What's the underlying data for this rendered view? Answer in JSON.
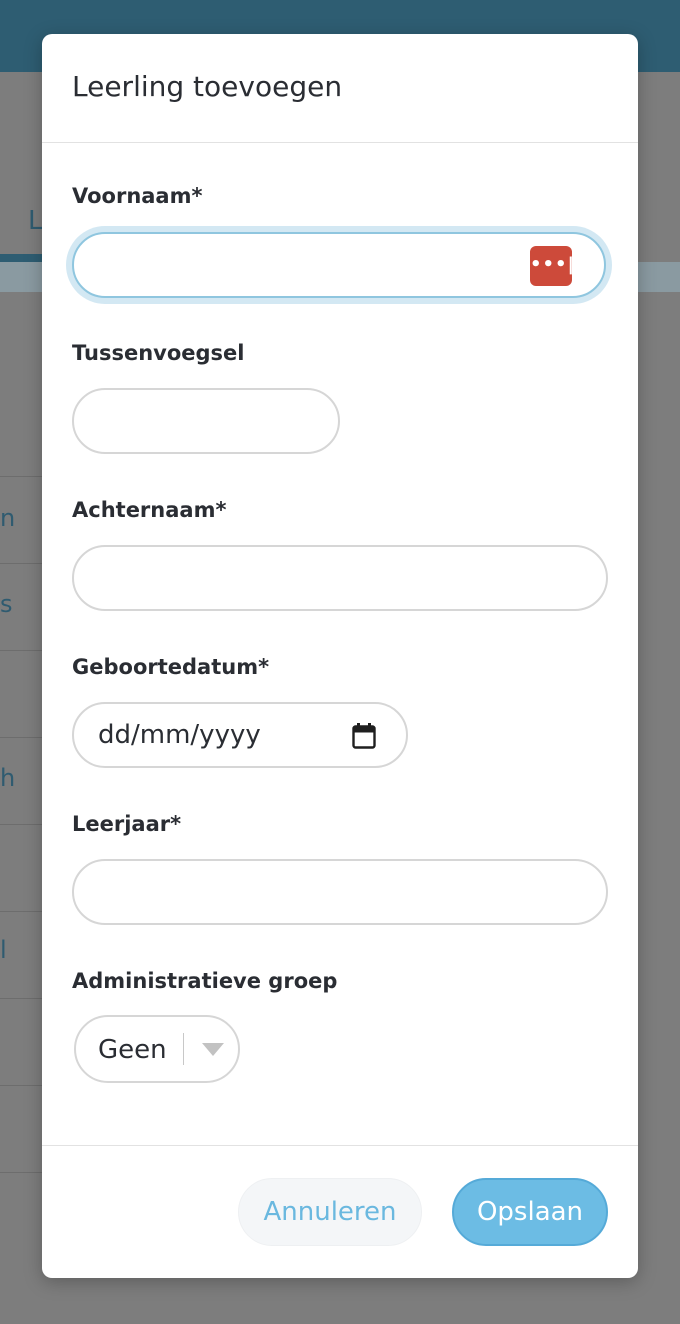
{
  "background": {
    "tab_text": "L",
    "row_texts": [
      "n",
      "s",
      "h",
      "l"
    ]
  },
  "modal": {
    "title": "Leerling toevoegen",
    "fields": {
      "voornaam": {
        "label": "Voornaam*",
        "value": ""
      },
      "tussenvoegsel": {
        "label": "Tussenvoegsel",
        "value": ""
      },
      "achternaam": {
        "label": "Achternaam*",
        "value": ""
      },
      "geboortedatum": {
        "label": "Geboortedatum*",
        "placeholder": "dd/mm/yyyy"
      },
      "leerjaar": {
        "label": "Leerjaar*",
        "value": ""
      },
      "groep": {
        "label": "Administratieve groep",
        "selected": "Geen"
      }
    },
    "password_manager_icon_text": "•••|",
    "buttons": {
      "cancel": "Annuleren",
      "save": "Opslaan"
    }
  },
  "colors": {
    "header": "#2e5d72",
    "focus_ring": "#d3e8f3",
    "primary": "#6cbce4",
    "password_manager": "#cd4a3a"
  },
  "icons": [
    "password-manager-icon",
    "calendar-icon",
    "chevron-down-icon"
  ]
}
